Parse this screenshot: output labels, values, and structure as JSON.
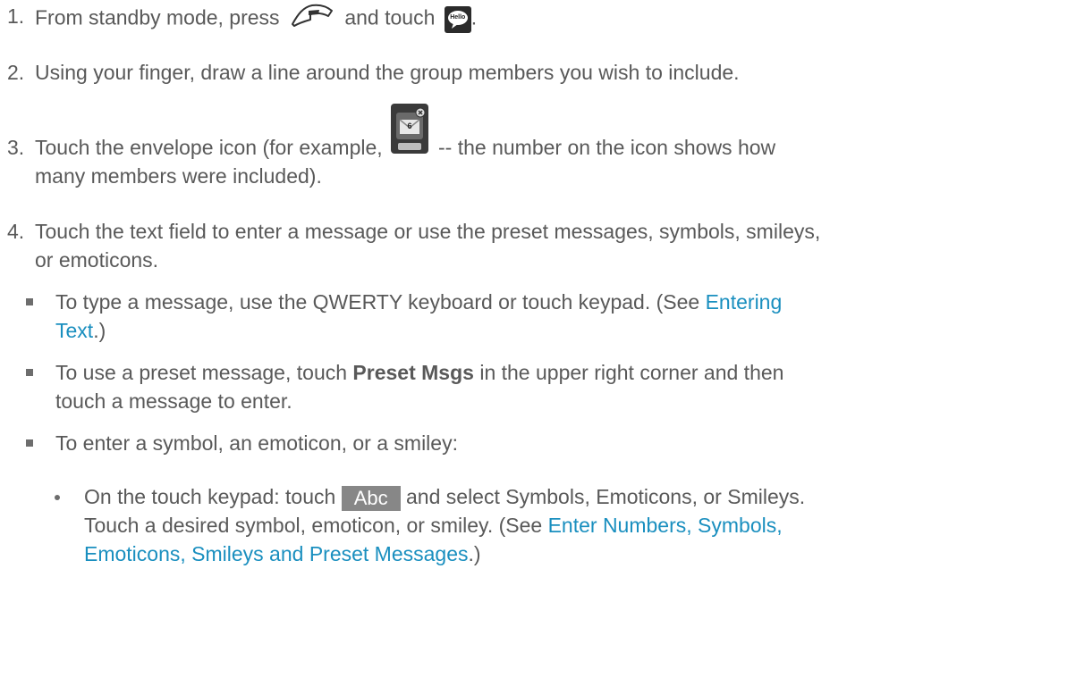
{
  "steps": [
    {
      "num": "1.",
      "text_a": "From standby mode, press",
      "text_b": "and touch",
      "text_c": "."
    },
    {
      "num": "2.",
      "text": "Using your finger, draw a line around the group members you wish to include."
    },
    {
      "num": "3.",
      "text_a": "Touch the envelope icon (for example,",
      "text_b": "-- the number on the icon shows how",
      "line2": "many members were included)."
    },
    {
      "num": "4.",
      "line1": "Touch the text field to enter a message or use the preset messages, symbols, smileys,",
      "line2": "or emoticons."
    }
  ],
  "bullets": [
    {
      "line1_a": "To type a message, use the QWERTY keyboard or touch keypad. (See",
      "link_a": "Entering",
      "link_b": "Text",
      "line2_b": ".)"
    },
    {
      "line1_a": "To use a preset message, touch",
      "bold": "Preset Msgs",
      "line1_b": "in the upper right corner and then",
      "line2": "touch a message to enter."
    },
    {
      "text": "To enter a symbol, an emoticon, or a smiley:"
    }
  ],
  "sub_bullet": {
    "a": "On the touch keypad: touch",
    "key": "Abc",
    "b": "and select Symbols, Emoticons, or Smileys.",
    "line2": "Touch a desired symbol, emoticon, or smiley. (See",
    "link1": "Enter Numbers, Symbols,",
    "link2": "Emoticons, Smileys and Preset Messages",
    "end": ".)"
  },
  "icons": {
    "talk_key": "talk-key-icon",
    "hello": "hello-app-icon",
    "hello_label": "Hello",
    "envelope": "envelope-count-icon",
    "envelope_count": "6"
  },
  "colors": {
    "text": "#595959",
    "link": "#1a8fbf",
    "key_bg": "#878787"
  }
}
